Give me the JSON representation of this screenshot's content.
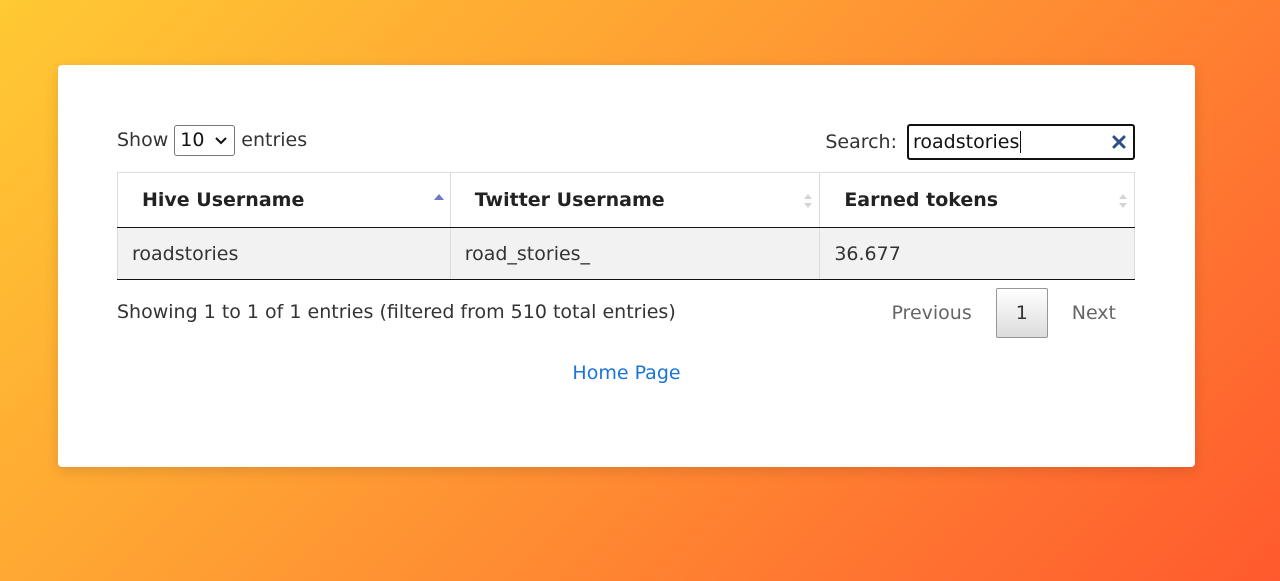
{
  "length_control": {
    "prefix": "Show",
    "selected": "10",
    "suffix": "entries"
  },
  "search": {
    "label": "Search:",
    "value": "roadstories"
  },
  "table": {
    "columns": [
      {
        "label": "Hive Username",
        "sort": "ascending"
      },
      {
        "label": "Twitter Username",
        "sort": "none"
      },
      {
        "label": "Earned tokens",
        "sort": "none"
      }
    ],
    "rows": [
      [
        "roadstories",
        "road_stories_",
        "36.677"
      ]
    ]
  },
  "info_text": "Showing 1 to 1 of 1 entries (filtered from 510 total entries)",
  "pagination": {
    "previous": "Previous",
    "current": "1",
    "next": "Next"
  },
  "home_link": "Home Page",
  "colors": {
    "link": "#1a73d9",
    "sort_active": "#6f78c8",
    "background_start": "#ffca33",
    "background_end": "#ff5a2e"
  }
}
